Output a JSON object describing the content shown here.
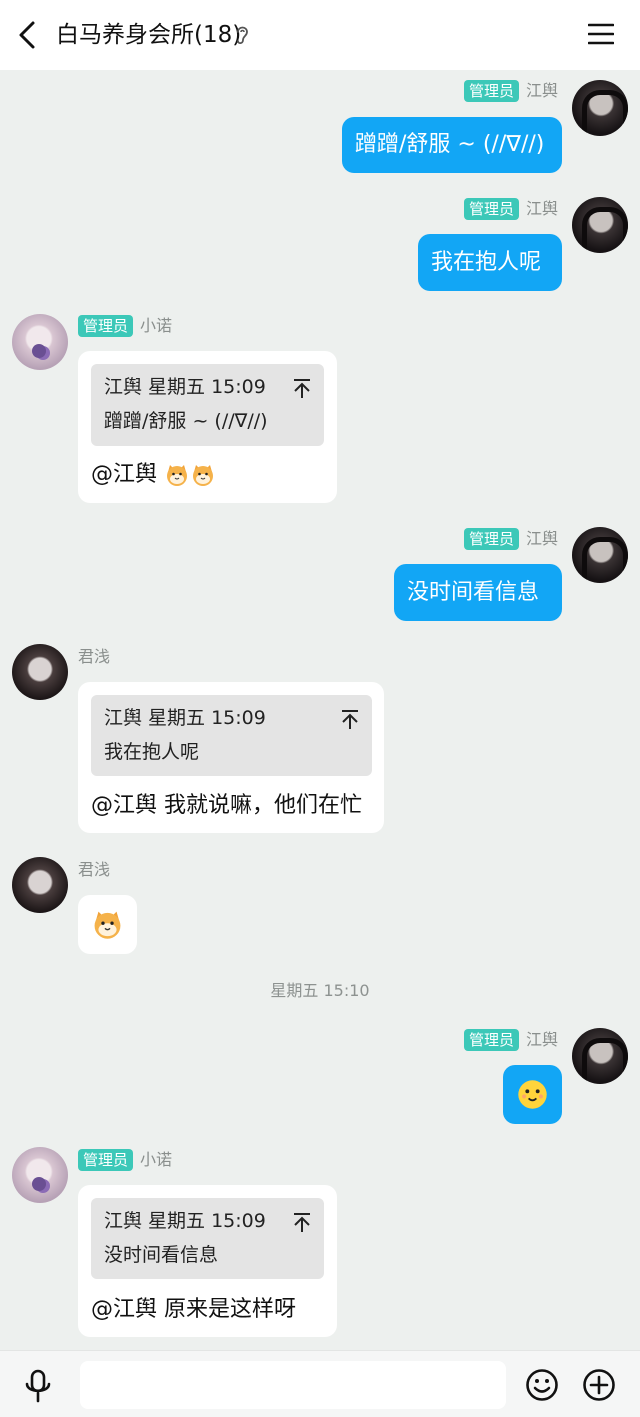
{
  "header": {
    "title": "白马养身会所(18)"
  },
  "badge_label": "管理员",
  "users": {
    "self": "江舆",
    "xiaonuo": "小诺",
    "junqian": "君浅"
  },
  "messages": {
    "m1": {
      "text": "蹭蹭/舒服 ~ (//∇//)"
    },
    "m2": {
      "text": "我在抱人呢"
    },
    "m3": {
      "quote_head": "江舆 星期五 15:09",
      "quote_text": "蹭蹭/舒服 ~ (//∇//)",
      "reply": "@江舆"
    },
    "m4": {
      "text": "没时间看信息"
    },
    "m5": {
      "quote_head": "江舆 星期五 15:09",
      "quote_text": "我在抱人呢",
      "reply": "@江舆 我就说嘛，他们在忙"
    },
    "m7": {
      "quote_head": "江舆 星期五 15:09",
      "quote_text": "没时间看信息",
      "reply": "@江舆 原来是这样呀"
    }
  },
  "timestamp": "星期五 15:10",
  "colors": {
    "bubble_self": "#12a6f5",
    "badge": "#3cc8b8",
    "background": "#edf0ee"
  },
  "icons": [
    "back-arrow-icon",
    "ear-icon",
    "menu-icon",
    "pin-top-icon",
    "shiba-emoji-icon",
    "smile-emoji-icon",
    "microphone-icon",
    "emoji-button-icon",
    "plus-circle-icon"
  ]
}
